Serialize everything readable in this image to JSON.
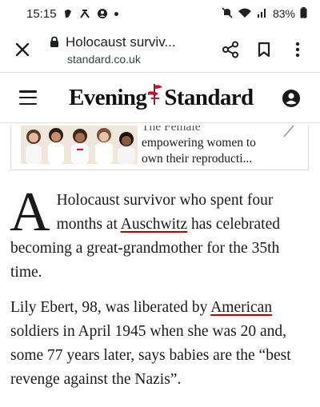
{
  "status_bar": {
    "time": "15:15",
    "battery": "83%"
  },
  "browser": {
    "tab_title": "Holocaust surviv...",
    "domain": "standard.co.uk"
  },
  "site": {
    "logo_left": "Evening",
    "logo_right": "Standard"
  },
  "related_card": {
    "line_clipped": "The Female",
    "line1": "empowering women to",
    "line2": "own their reproducti..."
  },
  "article": {
    "dropcap": "A",
    "p1_a": " Holocaust survivor who spent four months at ",
    "p1_link": "Auschwitz",
    "p1_b": " has celebrated becoming a great-grandmother for the 35th time.",
    "p2_a": "Lily Ebert, 98, was liberated by ",
    "p2_link": "American",
    "p2_b": " soldiers in April 1945 when she was 20 and, some 77 years later, says babies are the “best revenge against the Nazis”."
  },
  "colors": {
    "link_underline": "#b70000",
    "logo_flag": "#c8102e"
  },
  "icons": [
    "close-icon",
    "lock-icon",
    "share-icon",
    "bookmark-icon",
    "more-vert-icon",
    "menu-icon",
    "account-icon",
    "chevron-icon",
    "wifi-icon",
    "signal-icon",
    "battery-icon"
  ]
}
